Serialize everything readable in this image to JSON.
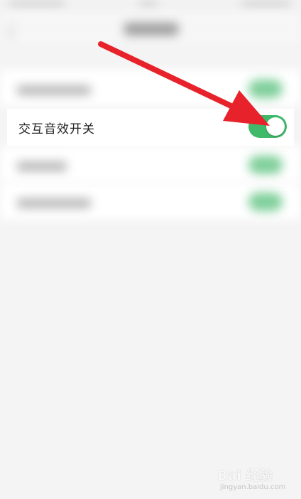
{
  "settings_list": {
    "active_item": {
      "label": "交互音效开关",
      "toggle_on": true,
      "toggle_color": "#3fb96a"
    }
  },
  "watermark": {
    "brand": "Bai 经验",
    "url": "jingyan.baidu.com"
  },
  "annotation": {
    "arrow_color": "#e8222a"
  }
}
